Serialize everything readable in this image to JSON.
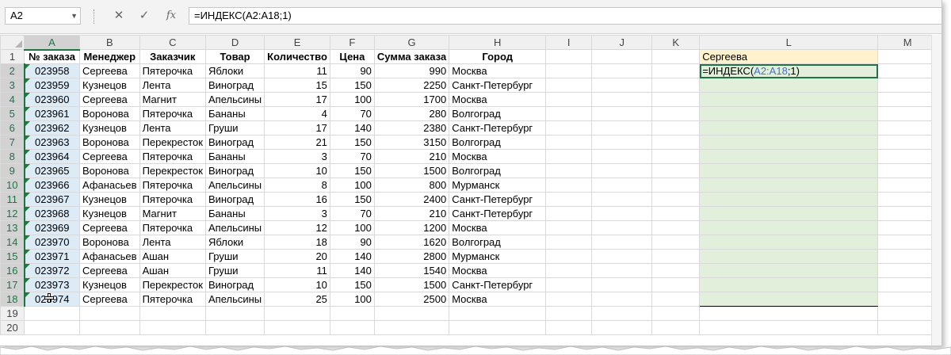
{
  "formula_bar": {
    "name_box": "A2",
    "cancel_icon": "✕",
    "enter_icon": "✓",
    "fx_label": "fx",
    "formula": "=ИНДЕКС(A2:A18;1)"
  },
  "columns": [
    "A",
    "B",
    "C",
    "D",
    "E",
    "F",
    "G",
    "H",
    "I",
    "J",
    "K",
    "L",
    "M"
  ],
  "rows": [
    "1",
    "2",
    "3",
    "4",
    "5",
    "6",
    "7",
    "8",
    "9",
    "10",
    "11",
    "12",
    "13",
    "14",
    "15",
    "16",
    "17",
    "18",
    "19",
    "20"
  ],
  "headers": [
    "№ заказа",
    "Менеджер",
    "Заказчик",
    "Товар",
    "Количество",
    "Цена",
    "Сумма заказа",
    "Город"
  ],
  "table": [
    [
      "023958",
      "Сергеева",
      "Пятерочка",
      "Яблоки",
      "11",
      "90",
      "990",
      "Москва"
    ],
    [
      "023959",
      "Кузнецов",
      "Лента",
      "Виноград",
      "15",
      "150",
      "2250",
      "Санкт-Петербург"
    ],
    [
      "023960",
      "Сергеева",
      "Магнит",
      "Апельсины",
      "17",
      "100",
      "1700",
      "Москва"
    ],
    [
      "023961",
      "Воронова",
      "Пятерочка",
      "Бананы",
      "4",
      "70",
      "280",
      "Волгоград"
    ],
    [
      "023962",
      "Кузнецов",
      "Лента",
      "Груши",
      "17",
      "140",
      "2380",
      "Санкт-Петербург"
    ],
    [
      "023963",
      "Воронова",
      "Перекресток",
      "Виноград",
      "21",
      "150",
      "3150",
      "Волгоград"
    ],
    [
      "023964",
      "Сергеева",
      "Пятерочка",
      "Бананы",
      "3",
      "70",
      "210",
      "Москва"
    ],
    [
      "023965",
      "Воронова",
      "Перекресток",
      "Виноград",
      "10",
      "150",
      "1500",
      "Волгоград"
    ],
    [
      "023966",
      "Афанасьев",
      "Пятерочка",
      "Апельсины",
      "8",
      "100",
      "800",
      "Мурманск"
    ],
    [
      "023967",
      "Кузнецов",
      "Пятерочка",
      "Виноград",
      "16",
      "150",
      "2400",
      "Санкт-Петербург"
    ],
    [
      "023968",
      "Кузнецов",
      "Магнит",
      "Бананы",
      "3",
      "70",
      "210",
      "Санкт-Петербург"
    ],
    [
      "023969",
      "Сергеева",
      "Пятерочка",
      "Апельсины",
      "12",
      "100",
      "1200",
      "Москва"
    ],
    [
      "023970",
      "Воронова",
      "Лента",
      "Яблоки",
      "18",
      "90",
      "1620",
      "Волгоград"
    ],
    [
      "023971",
      "Афанасьев",
      "Ашан",
      "Груши",
      "20",
      "140",
      "2800",
      "Мурманск"
    ],
    [
      "023972",
      "Сергеева",
      "Ашан",
      "Груши",
      "11",
      "140",
      "1540",
      "Москва"
    ],
    [
      "023973",
      "Кузнецов",
      "Перекресток",
      "Виноград",
      "10",
      "150",
      "1500",
      "Санкт-Петербург"
    ],
    [
      "023974",
      "Сергеева",
      "Пятерочка",
      "Апельсины",
      "25",
      "100",
      "2500",
      "Москва"
    ]
  ],
  "l_column": {
    "header_value": "Сергеева",
    "formula_prefix": "=ИНДЕКС(",
    "formula_ref": "A2:A18",
    "formula_suffix": ";1)"
  },
  "colors": {
    "selection_fill": "#ddebf7",
    "result_fill": "#e2efda",
    "header_fill": "#fff2cc",
    "excel_green": "#217346",
    "ref_blue": "#4472c4"
  }
}
